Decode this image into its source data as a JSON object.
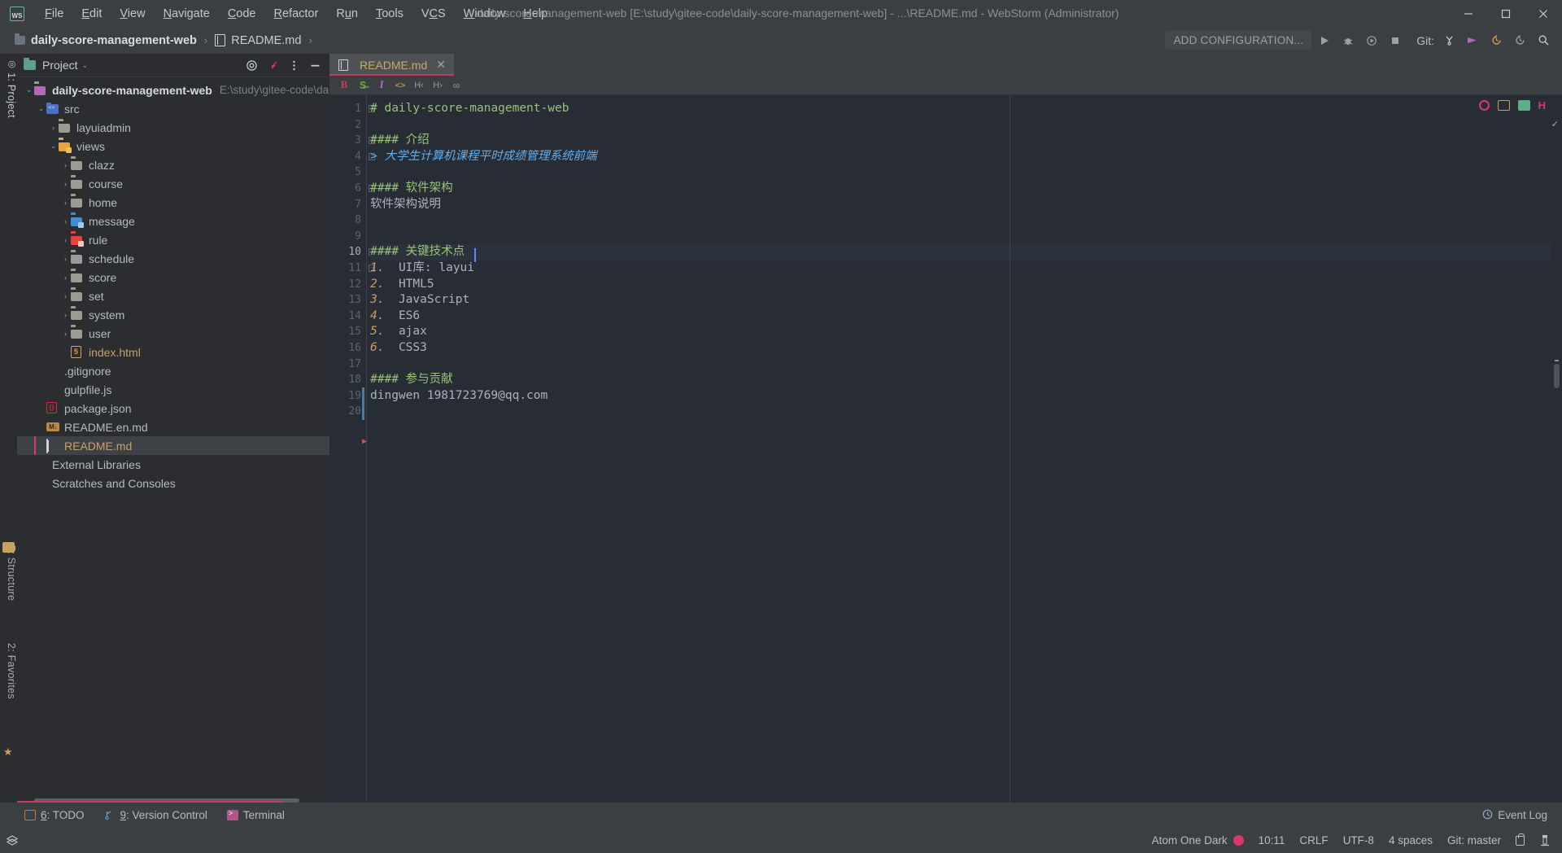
{
  "window": {
    "title": "daily-score-management-web [E:\\study\\gitee-code\\daily-score-management-web] - ...\\README.md - WebStorm (Administrator)",
    "logo": "ws-logo",
    "minimize": "–",
    "maximize": "▢",
    "close": "✕"
  },
  "menu": [
    {
      "label": "File",
      "icon": "menu-file"
    },
    {
      "label": "Edit",
      "icon": "menu-edit"
    },
    {
      "label": "View",
      "icon": "menu-view"
    },
    {
      "label": "Navigate",
      "icon": "menu-navigate"
    },
    {
      "label": "Code",
      "icon": "menu-code"
    },
    {
      "label": "Refactor",
      "icon": "menu-refactor"
    },
    {
      "label": "Run",
      "icon": "menu-run"
    },
    {
      "label": "Tools",
      "icon": "menu-tools"
    },
    {
      "label": "VCS",
      "icon": "menu-vcs"
    },
    {
      "label": "Window",
      "icon": "menu-window"
    },
    {
      "label": "Help",
      "icon": "menu-help"
    }
  ],
  "breadcrumb": {
    "root": "daily-score-management-web",
    "separator": "›",
    "file": "README.md",
    "trailing": "›"
  },
  "toolbar": {
    "add_configuration": "ADD CONFIGURATION...",
    "run_icon": "run-icon",
    "debug_icon": "debug-icon",
    "run_with_coverage_icon": "coverage-icon",
    "stop_icon": "stop-icon",
    "git_label": "Git:",
    "branch_icon": "branch-icon",
    "push_icon": "push-icon",
    "update_icon": "update-project-icon",
    "rollback_icon": "rollback-icon",
    "search_icon": "search-icon"
  },
  "vertical_tabs": [
    {
      "label": "1: Project",
      "icon": "project-icon"
    },
    {
      "label": "7: Structure",
      "icon": "structure-icon"
    },
    {
      "label": "2: Favorites",
      "icon": "favorites-icon"
    }
  ],
  "project_panel": {
    "title": "Project",
    "chevron": "⌄",
    "actions": [
      {
        "name": "select-opened-file-icon",
        "glyph": "◎"
      },
      {
        "name": "collapse-all-icon",
        "glyph": "↙"
      },
      {
        "name": "options-icon",
        "glyph": "⋮"
      },
      {
        "name": "hide-icon",
        "glyph": "—"
      }
    ],
    "tree": [
      {
        "label": "daily-score-management-web",
        "sub": "E:\\study\\gitee-code\\daily-score-man",
        "indent": 0,
        "arrow": "⌄",
        "icon": "folder-root",
        "bold": true
      },
      {
        "label": "src",
        "sub": "",
        "indent": 1,
        "arrow": "⌄",
        "icon": "folder-source"
      },
      {
        "label": "layuiadmin",
        "sub": "",
        "indent": 2,
        "arrow": "›",
        "icon": "folder"
      },
      {
        "label": "views",
        "sub": "",
        "indent": 2,
        "arrow": "⌄",
        "icon": "folder-orange"
      },
      {
        "label": "clazz",
        "sub": "",
        "indent": 3,
        "arrow": "›",
        "icon": "folder"
      },
      {
        "label": "course",
        "sub": "",
        "indent": 3,
        "arrow": "›",
        "icon": "folder"
      },
      {
        "label": "home",
        "sub": "",
        "indent": 3,
        "arrow": "›",
        "icon": "folder"
      },
      {
        "label": "message",
        "sub": "",
        "indent": 3,
        "arrow": "›",
        "icon": "folder-blue"
      },
      {
        "label": "rule",
        "sub": "",
        "indent": 3,
        "arrow": "›",
        "icon": "folder-red"
      },
      {
        "label": "schedule",
        "sub": "",
        "indent": 3,
        "arrow": "›",
        "icon": "folder"
      },
      {
        "label": "score",
        "sub": "",
        "indent": 3,
        "arrow": "›",
        "icon": "folder"
      },
      {
        "label": "set",
        "sub": "",
        "indent": 3,
        "arrow": "›",
        "icon": "folder"
      },
      {
        "label": "system",
        "sub": "",
        "indent": 3,
        "arrow": "›",
        "icon": "folder"
      },
      {
        "label": "user",
        "sub": "",
        "indent": 3,
        "arrow": "›",
        "icon": "folder"
      },
      {
        "label": "index.html",
        "sub": "",
        "indent": 3,
        "arrow": "",
        "icon": "html5-file"
      },
      {
        "label": ".gitignore",
        "sub": "",
        "indent": 1,
        "arrow": "",
        "icon": "gitignore-file"
      },
      {
        "label": "gulpfile.js",
        "sub": "",
        "indent": 1,
        "arrow": "",
        "icon": "gulp-file"
      },
      {
        "label": "package.json",
        "sub": "",
        "indent": 1,
        "arrow": "",
        "icon": "json-file"
      },
      {
        "label": "README.en.md",
        "sub": "",
        "indent": 1,
        "arrow": "",
        "icon": "markdown-file"
      },
      {
        "label": "README.md",
        "sub": "",
        "indent": 1,
        "arrow": "",
        "icon": "markdown-book",
        "selected": true
      },
      {
        "label": "External Libraries",
        "sub": "",
        "indent": 0,
        "arrow": "",
        "icon": "library-icon"
      },
      {
        "label": "Scratches and Consoles",
        "sub": "",
        "indent": 0,
        "arrow": "",
        "icon": "scratch-icon"
      }
    ]
  },
  "editor": {
    "tab": {
      "label": "README.md",
      "icon": "markdown-book-icon",
      "close": "✕"
    },
    "markdown_toolbar": [
      {
        "name": "bold-icon",
        "glyph": "B",
        "color": "#c7395f"
      },
      {
        "name": "strikethrough-icon",
        "glyph": "S̶",
        "color": "#6aa84f"
      },
      {
        "name": "italic-icon",
        "glyph": "I",
        "color": "#b46fd0"
      },
      {
        "name": "code-icon",
        "glyph": "<>",
        "color": "#c7a25c"
      },
      {
        "name": "header-icon",
        "glyph": "H‹",
        "color": "#8f98a3"
      },
      {
        "name": "header-level-icon",
        "glyph": "H›",
        "color": "#8f98a3"
      },
      {
        "name": "link-icon",
        "glyph": "∞",
        "color": "#8f98a3"
      }
    ],
    "inspector": [
      {
        "name": "inspections-widget-icon",
        "glyph": "●"
      },
      {
        "name": "split-preview-icon",
        "glyph": "▤"
      },
      {
        "name": "preview-icon",
        "glyph": "▧"
      },
      {
        "name": "hector-icon",
        "glyph": "H"
      }
    ],
    "lines": [
      {
        "no": "1",
        "text": "# daily-score-management-web",
        "style": "h1",
        "fold": "−"
      },
      {
        "no": "2",
        "text": "",
        "style": "",
        "fold": ""
      },
      {
        "no": "3",
        "text": "#### 介绍",
        "style": "h1",
        "fold": "−"
      },
      {
        "no": "4",
        "text": "> 大学生计算机课程平时成绩管理系统前端",
        "style": "hq",
        "fold": "−"
      },
      {
        "no": "5",
        "text": "",
        "style": "",
        "fold": ""
      },
      {
        "no": "6",
        "text": "#### 软件架构",
        "style": "h1",
        "fold": "−"
      },
      {
        "no": "7",
        "text": "软件架构说明",
        "style": "",
        "fold": ""
      },
      {
        "no": "8",
        "text": "",
        "style": "",
        "fold": ""
      },
      {
        "no": "9",
        "text": "",
        "style": "",
        "fold": ""
      },
      {
        "no": "10",
        "text": "#### 关键技术点",
        "style": "h1",
        "fold": "−",
        "current": true
      },
      {
        "no": "11",
        "text": "1.  UI库: layui",
        "style": "listnum",
        "fold": "−"
      },
      {
        "no": "12",
        "text": "2.  HTML5",
        "style": "listnum",
        "fold": ""
      },
      {
        "no": "13",
        "text": "3.  JavaScript",
        "style": "listnum",
        "fold": ""
      },
      {
        "no": "14",
        "text": "4.  ES6",
        "style": "listnum",
        "fold": ""
      },
      {
        "no": "15",
        "text": "5.  ajax",
        "style": "listnum",
        "fold": ""
      },
      {
        "no": "16",
        "text": "6.  CSS3",
        "style": "listnum",
        "fold": ""
      },
      {
        "no": "17",
        "text": "",
        "style": "",
        "fold": ""
      },
      {
        "no": "18",
        "text": "#### 参与贡献",
        "style": "h1",
        "fold": ""
      },
      {
        "no": "19",
        "text": "dingwen 1981723769@qq.com",
        "style": "",
        "fold": ""
      },
      {
        "no": "20",
        "text": "",
        "style": "",
        "fold": ""
      }
    ]
  },
  "tool_windows": [
    {
      "num": "6",
      "label": ": TODO",
      "icon": "todo-icon"
    },
    {
      "num": "9",
      "label": ": Version Control",
      "icon": "version-control-icon"
    },
    {
      "num": "",
      "label": "Terminal",
      "icon": "terminal-icon"
    }
  ],
  "event_log": {
    "label": "Event Log",
    "icon": "event-log-icon"
  },
  "status_bar": {
    "theme": "Atom One Dark",
    "indicator_color": "#d8386b",
    "caret_position": "10:11",
    "line_separator": "CRLF",
    "encoding": "UTF-8",
    "indent": "4 spaces",
    "git_branch": "Git: master",
    "lock_icon": "lock-icon",
    "memory_icon": "inspector-icon",
    "layers_icon": "layers-icon"
  }
}
